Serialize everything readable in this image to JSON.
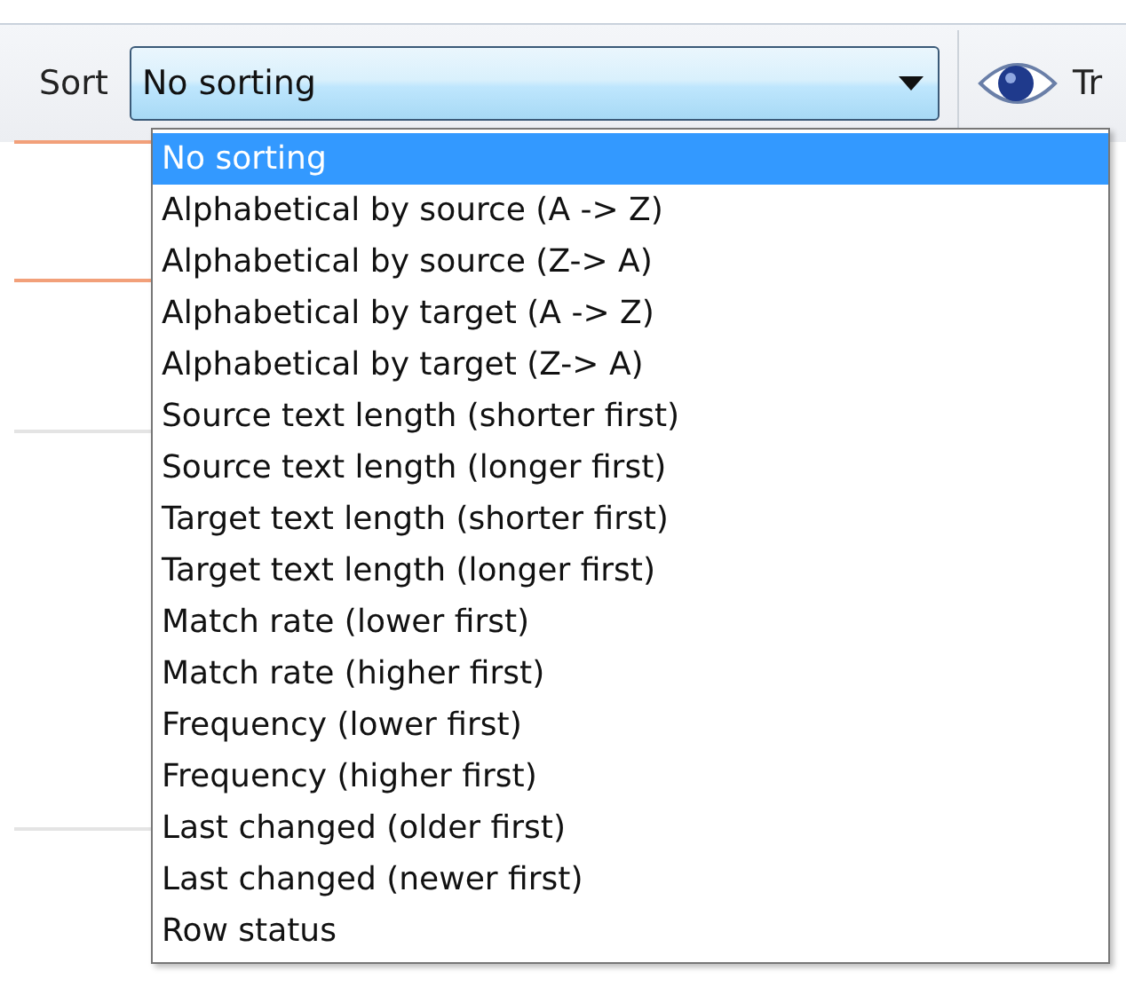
{
  "toolbar": {
    "sort_label": "Sort",
    "sort_value": "No sorting",
    "next_label": "Tr"
  },
  "options": [
    {
      "label": "No sorting",
      "selected": true
    },
    {
      "label": "Alphabetical by source (A -> Z)",
      "selected": false
    },
    {
      "label": "Alphabetical by source (Z-> A)",
      "selected": false
    },
    {
      "label": "Alphabetical by target (A -> Z)",
      "selected": false
    },
    {
      "label": "Alphabetical by target (Z-> A)",
      "selected": false
    },
    {
      "label": "Source text length (shorter first)",
      "selected": false
    },
    {
      "label": "Source text length (longer first)",
      "selected": false
    },
    {
      "label": "Target text length (shorter first)",
      "selected": false
    },
    {
      "label": "Target text length (longer first)",
      "selected": false
    },
    {
      "label": "Match rate (lower first)",
      "selected": false
    },
    {
      "label": "Match rate (higher first)",
      "selected": false
    },
    {
      "label": "Frequency (lower first)",
      "selected": false
    },
    {
      "label": "Frequency (higher first)",
      "selected": false
    },
    {
      "label": "Last changed (older first)",
      "selected": false
    },
    {
      "label": "Last changed (newer first)",
      "selected": false
    },
    {
      "label": "Row status",
      "selected": false
    }
  ]
}
